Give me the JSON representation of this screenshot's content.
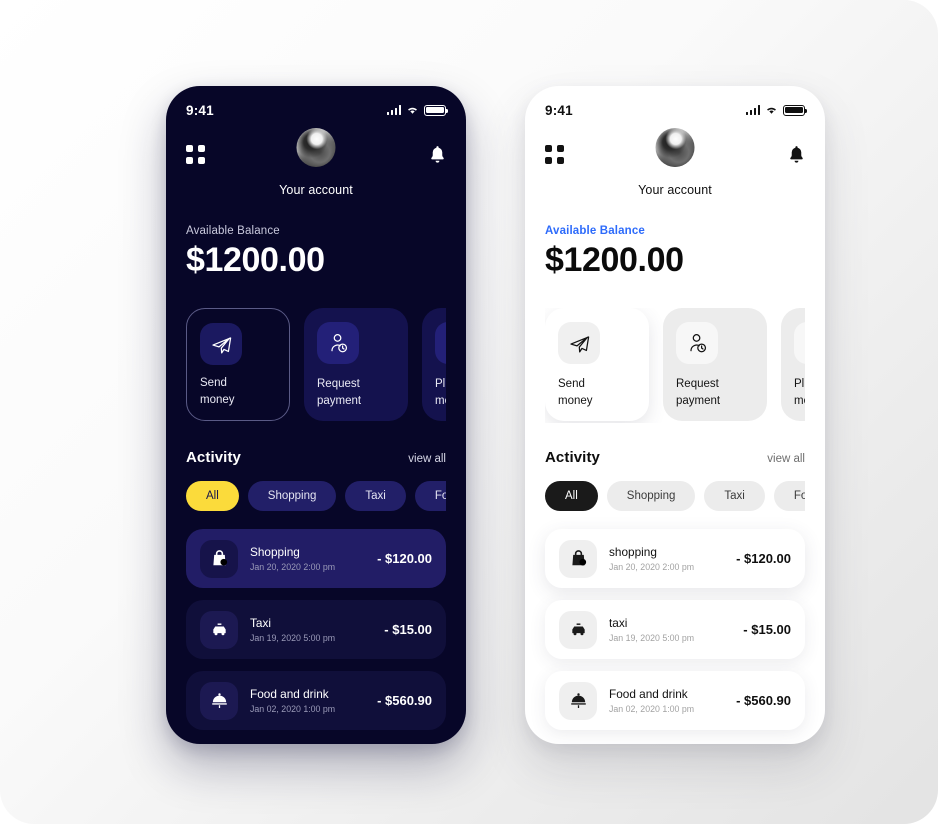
{
  "theme_colors": {
    "dark_bg": "#070628",
    "dark_card": "#14124e",
    "dark_chip": "#221f68",
    "accent_yellow": "#fbdb3b",
    "accent_blue": "#2d6bfb",
    "light_bg": "#ffffff",
    "light_chip": "#ececec",
    "light_chip_active": "#1a1a1a"
  },
  "status_bar": {
    "time": "9:41",
    "signal_icon": "cellular-signal-icon",
    "wifi_icon": "wifi-icon",
    "battery_icon": "battery-icon"
  },
  "nav": {
    "grid_icon": "grid-menu-icon",
    "avatar": "user-avatar",
    "bell_icon": "notification-bell-icon",
    "account_label": "Your account"
  },
  "balance": {
    "label": "Available Balance",
    "amount": "$1200.00"
  },
  "actions": [
    {
      "id": "send-money",
      "label": "Send\nmoney",
      "icon": "paper-plane-icon",
      "selected": true
    },
    {
      "id": "request-payment",
      "label": "Request\npayment",
      "icon": "person-clock-icon",
      "selected": false
    },
    {
      "id": "plus-money",
      "label": "Plus\nmoney",
      "icon": "money-circle-icon",
      "selected": false
    }
  ],
  "activity": {
    "title": "Activity",
    "view_all": "view all"
  },
  "chips": [
    {
      "label": "All",
      "active": true
    },
    {
      "label": "Shopping",
      "active": false
    },
    {
      "label": "Taxi",
      "active": false
    },
    {
      "label": "Food",
      "active": false
    }
  ],
  "transactions_dark": [
    {
      "title": "Shopping",
      "date": "Jan 20, 2020 2:00 pm",
      "amount": "- $120.00",
      "icon": "shopping-bag-icon",
      "highlight": true
    },
    {
      "title": "Taxi",
      "date": "Jan 19, 2020 5:00 pm",
      "amount": "- $15.00",
      "icon": "taxi-car-icon",
      "highlight": false
    },
    {
      "title": "Food and drink",
      "date": "Jan 02, 2020 1:00 pm",
      "amount": "- $560.90",
      "icon": "food-cloche-icon",
      "highlight": false
    }
  ],
  "transactions_light": [
    {
      "title": "shopping",
      "date": "Jan 20, 2020 2:00 pm",
      "amount": "- $120.00",
      "icon": "shopping-bag-icon",
      "highlight": true
    },
    {
      "title": "taxi",
      "date": "Jan 19, 2020 5:00 pm",
      "amount": "- $15.00",
      "icon": "taxi-car-icon",
      "highlight": false
    },
    {
      "title": "Food and drink",
      "date": "Jan 02, 2020 1:00 pm",
      "amount": "- $560.90",
      "icon": "food-cloche-icon",
      "highlight": false
    }
  ]
}
